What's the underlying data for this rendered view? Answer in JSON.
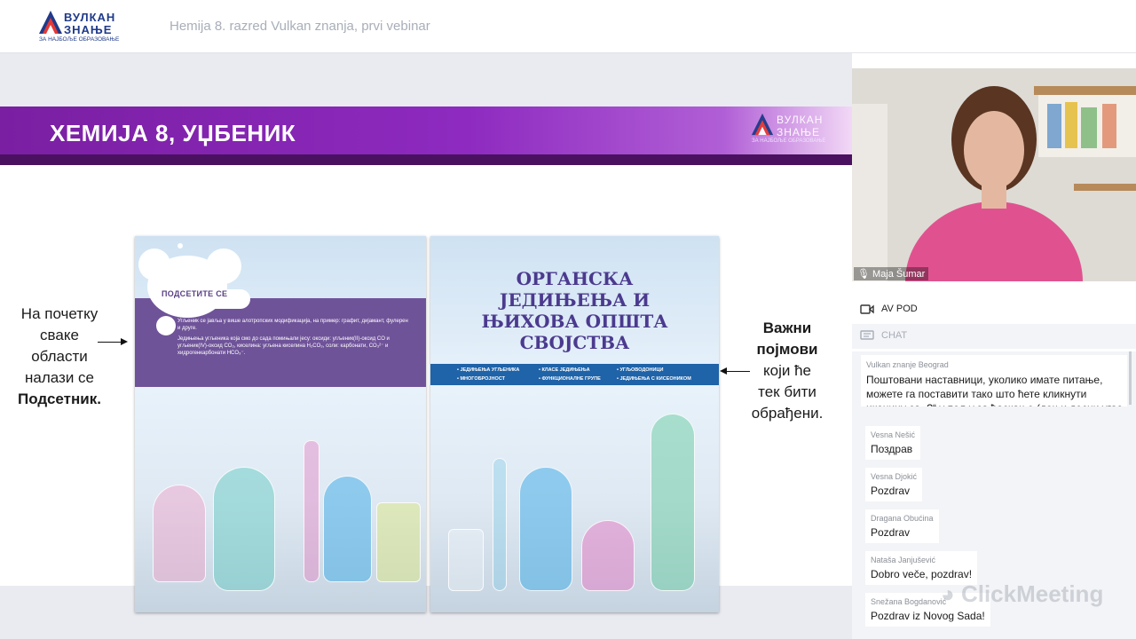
{
  "header": {
    "logo_line1": "ВУЛКАН",
    "logo_line2": "ЗНАЊЕ",
    "logo_tagline": "ЗА НАЈБОЉЕ ОБРАЗОВАЊЕ",
    "webinar_title": "Hemija 8. razred Vulkan znanja, prvi vebinar"
  },
  "slide": {
    "title": "ХЕМИЈА 8, УЏБЕНИК",
    "logo_line1": "ВУЛКАН",
    "logo_line2": "ЗНАЊЕ",
    "logo_tagline": "ЗА НАЈБОЉЕ ОБРАЗОВАЊЕ",
    "left_note": {
      "line1": "На почетку",
      "line2": "сваке",
      "line3": "области",
      "line4": "налази се",
      "line5": "Подсетник."
    },
    "right_note": {
      "line1": "Важни",
      "line2": "појмови",
      "line3": "који ће",
      "line4": "тек бити",
      "line5": "обрађени."
    },
    "left_page": {
      "box_title": "ПОДСЕТИТЕ СЕ",
      "bullet1": "Угљеник се јавља у више алотропских модификација, на пример: графит, дијамант, фулерен и друге.",
      "bullet2": "Једињења угљеника која смо до сада помињали јесу: оксиди: угљеник(II)-оксид CO и угљеник(IV)-оксид CO₂, киселина: угљена киселина H₂CO₃, соли: карбонати, CO₃²⁻ и хидрогенкарбонати HCO₃⁻."
    },
    "right_page": {
      "title_line1": "ОРГАНСКА",
      "title_line2": "ЈЕДИЊЕЊА И",
      "title_line3": "ЊИХОВА ОПШТА",
      "title_line4": "СВОЈСТВА",
      "band_items": [
        "• ЈЕДИЊЕЊА УГЉЕНИКА",
        "• КЛАСЕ ЈЕДИЊЕЊА",
        "• УГЉОВОДОНИЦИ",
        "• МНОГОБРОЈНОСТ",
        "• ФУНКЦИОНАЛНЕ ГРУПЕ",
        "• ЈЕДИЊЕЊА С КИСЕОНИКОМ"
      ]
    }
  },
  "panel": {
    "presenter_name": "Maja Šumar",
    "av_label": "AV POD",
    "chat_label": "CHAT",
    "pinned": {
      "author": "Vulkan znanje Beograd",
      "text": "Поштовани наставници, уколико имате питање, можете га поставити тако што ћете кликнути иконицу са „?“ у пољу за ћаскање (доњи десни угао"
    },
    "messages": [
      {
        "author": "Vesna Nešić",
        "text": "Поздрав"
      },
      {
        "author": "Vesna Djokić",
        "text": "Pozdrav"
      },
      {
        "author": "Dragana Obućina",
        "text": "Pozdrav"
      },
      {
        "author": "Nataša Janjušević",
        "text": "Dobro veče, pozdrav!"
      },
      {
        "author": "Snežana Bogdanović",
        "text": "Pozdrav iz Novog Sada!"
      }
    ],
    "watermark": "ClickMeeting"
  },
  "colors": {
    "header_purple": "#7a1fa2",
    "book_purple": "#6f5399",
    "book_blue": "#1f63a8",
    "logo_blue": "#1f3a8a"
  }
}
